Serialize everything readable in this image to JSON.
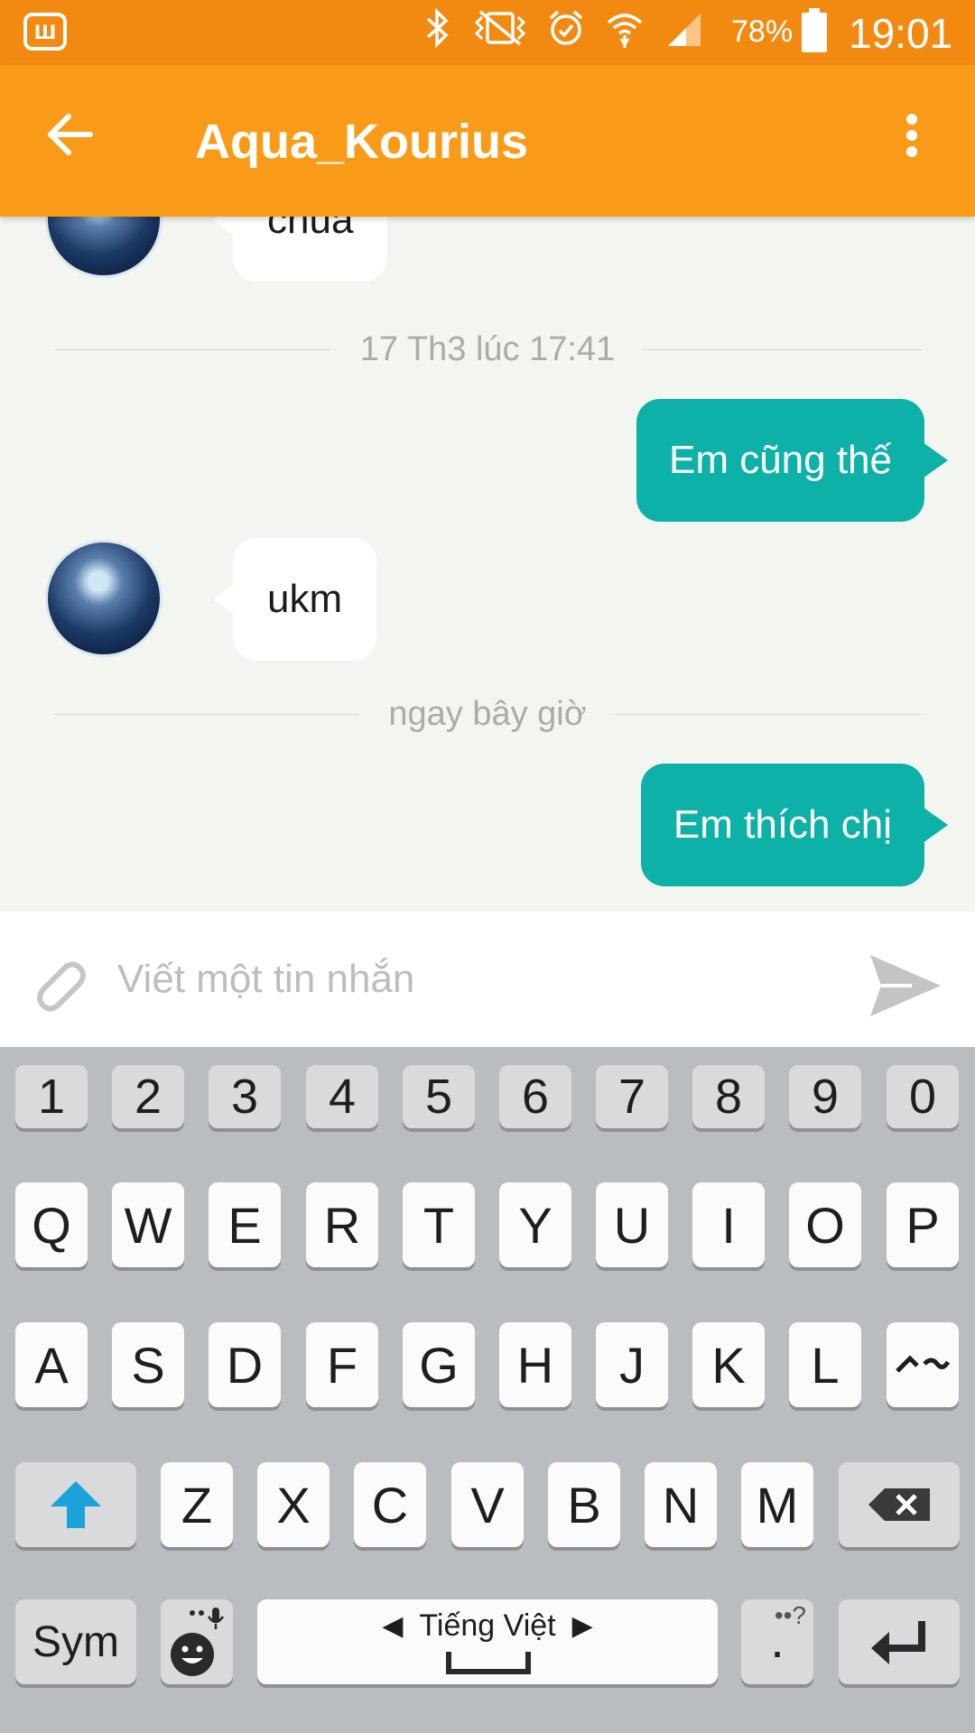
{
  "status_bar": {
    "app_icon_letter": "ш",
    "icons": [
      "bluetooth-icon",
      "vibrate-icon",
      "alarm-icon",
      "wifi-icon",
      "signal-icon"
    ],
    "battery": "78%",
    "time": "19:01"
  },
  "app_bar": {
    "back_icon": "arrow-left-icon",
    "title": "Aqua_Kourius",
    "more_icon": "more-vert-icon",
    "color": "#f99b18"
  },
  "messages": [
    {
      "type": "incoming",
      "text": "chua"
    },
    {
      "type": "divider",
      "text": "17 Th3 lúc 17:41"
    },
    {
      "type": "outgoing",
      "text": "Em cũng thế"
    },
    {
      "type": "incoming",
      "text": "ukm"
    },
    {
      "type": "divider",
      "text": "ngay bây giờ"
    },
    {
      "type": "outgoing",
      "text": "Em thích chị"
    }
  ],
  "composer": {
    "placeholder": "Viết một tin nhắn",
    "attach_icon": "paperclip-icon",
    "send_icon": "send-icon"
  },
  "keyboard": {
    "number_row": [
      "1",
      "2",
      "3",
      "4",
      "5",
      "6",
      "7",
      "8",
      "9",
      "0"
    ],
    "row1": [
      "Q",
      "W",
      "E",
      "R",
      "T",
      "Y",
      "U",
      "I",
      "O",
      "P"
    ],
    "row2": [
      "A",
      "S",
      "D",
      "F",
      "G",
      "H",
      "J",
      "K",
      "L"
    ],
    "row3": [
      "Z",
      "X",
      "C",
      "V",
      "B",
      "N",
      "M"
    ],
    "sym": "Sym",
    "language": "Tiếng Việt",
    "punct": ".",
    "punct_hint": "••?"
  },
  "colors": {
    "status_bar": "#f28a12",
    "outgoing_bubble": "#0db1a8",
    "accent": "#1aa3d8"
  }
}
